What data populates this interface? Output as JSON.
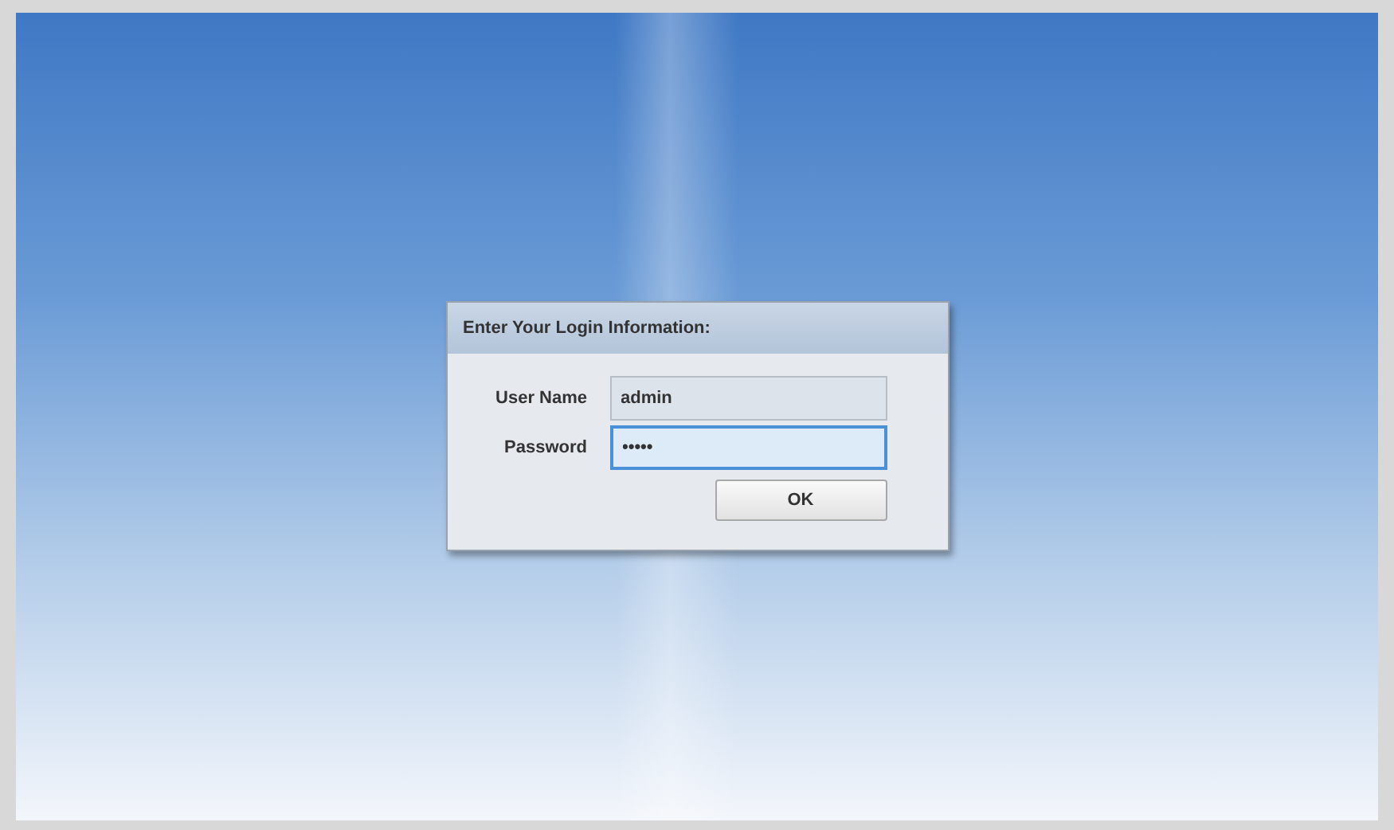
{
  "dialog": {
    "title": "Enter Your Login Information:",
    "fields": [
      {
        "label": "User Name",
        "value": "admin",
        "focused": false
      },
      {
        "label": "Password",
        "value": "•••••",
        "focused": true
      }
    ],
    "buttons": [
      "OK"
    ]
  }
}
